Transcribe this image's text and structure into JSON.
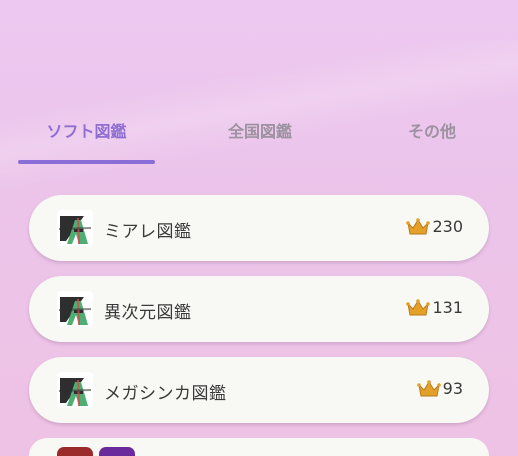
{
  "tabs": [
    {
      "label": "ソフト図鑑",
      "active": true
    },
    {
      "label": "全国図鑑",
      "active": false
    },
    {
      "label": "その他",
      "active": false
    }
  ],
  "dex_list": [
    {
      "name": "ミアレ図鑑",
      "count": "230",
      "icon": "za-logo-icon"
    },
    {
      "name": "異次元図鑑",
      "count": "131",
      "icon": "za-logo-icon"
    },
    {
      "name": "メガシンカ図鑑",
      "count": "93",
      "icon": "za-logo-icon"
    }
  ],
  "colors": {
    "accent": "#8a6dd6",
    "crown": "#e3a12a",
    "card_bg": "#f8f8f4",
    "tab_inactive": "#9c92a0"
  }
}
